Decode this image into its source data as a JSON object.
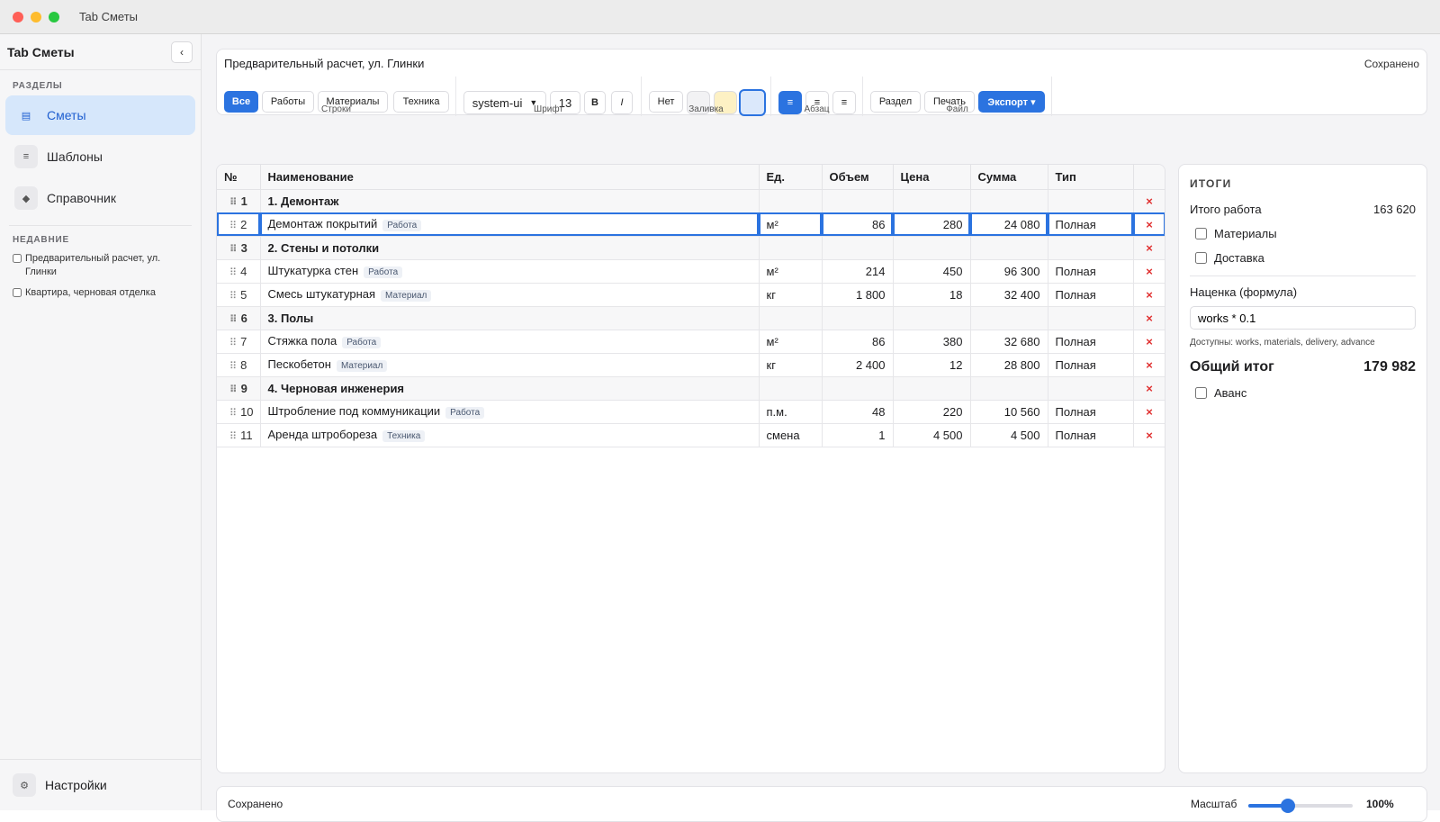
{
  "window": {
    "title": "Tab Сметы"
  },
  "sidebar": {
    "title": "Tab Сметы",
    "collapse_label": "‹",
    "sections_label": "РАЗДЕЛЫ",
    "items": [
      {
        "label": "Сметы",
        "icon": "▤",
        "active": true
      },
      {
        "label": "Шаблоны",
        "icon": "≡",
        "active": false
      },
      {
        "label": "Справочник",
        "icon": "◆",
        "active": false
      }
    ],
    "recent_label": "НЕДАВНИЕ",
    "recent": [
      {
        "label": "Предварительный расчет, ул. Глинки"
      },
      {
        "label": "Квартира, черновая отделка"
      }
    ],
    "settings": {
      "label": "Настройки",
      "icon": "⚙"
    }
  },
  "toolbar": {
    "doc_title": "Предварительный расчет, ул. Глинки",
    "status": "Сохранено",
    "rows_group": {
      "label": "Строки",
      "buttons": [
        "Все",
        "Работы",
        "Материалы",
        "Техника"
      ]
    },
    "font_group": {
      "label": "Шрифт",
      "font": "system-ui",
      "size": "13",
      "bold": "B",
      "italic": "I"
    },
    "fill_group": {
      "label": "Заливка",
      "none": "Нет",
      "colors": [
        "#f2f2f4",
        "#fdf1c4",
        "#dbe8fb"
      ]
    },
    "para_group": {
      "label": "Абзац",
      "buttons": [
        "≡",
        "≡",
        "≡"
      ]
    },
    "file_group": {
      "label": "Файл",
      "section": "Раздел",
      "print": "Печать",
      "export": "Экспорт ▾"
    }
  },
  "table": {
    "columns": [
      "№",
      "Наименование",
      "Ед.",
      "Объем",
      "Цена",
      "Сумма",
      "Тип",
      ""
    ],
    "rows": [
      {
        "n": "1",
        "name": "1. Демонтаж",
        "section": true
      },
      {
        "n": "2",
        "name": "Демонтаж покрытий",
        "tag": "Работа",
        "unit": "м²",
        "qty": "86",
        "price": "280",
        "sum": "24 080",
        "type": "Полная",
        "selected": true
      },
      {
        "n": "3",
        "name": "2. Стены и потолки",
        "section": true
      },
      {
        "n": "4",
        "name": "Штукатурка стен",
        "tag": "Работа",
        "unit": "м²",
        "qty": "214",
        "price": "450",
        "sum": "96 300",
        "type": "Полная"
      },
      {
        "n": "5",
        "name": "Смесь штукатурная",
        "tag": "Материал",
        "unit": "кг",
        "qty": "1 800",
        "price": "18",
        "sum": "32 400",
        "type": "Полная"
      },
      {
        "n": "6",
        "name": "3. Полы",
        "section": true
      },
      {
        "n": "7",
        "name": "Стяжка пола",
        "tag": "Работа",
        "unit": "м²",
        "qty": "86",
        "price": "380",
        "sum": "32 680",
        "type": "Полная"
      },
      {
        "n": "8",
        "name": "Пескобетон",
        "tag": "Материал",
        "unit": "кг",
        "qty": "2 400",
        "price": "12",
        "sum": "28 800",
        "type": "Полная"
      },
      {
        "n": "9",
        "name": "4. Черновая инженерия",
        "section": true
      },
      {
        "n": "10",
        "name": "Штробление под коммуникации",
        "tag": "Работа",
        "unit": "п.м.",
        "qty": "48",
        "price": "220",
        "sum": "10 560",
        "type": "Полная"
      },
      {
        "n": "11",
        "name": "Аренда штробореза",
        "tag": "Техника",
        "unit": "смена",
        "qty": "1",
        "price": "4 500",
        "sum": "4 500",
        "type": "Полная"
      }
    ],
    "delete_glyph": "×",
    "grip_glyph": "⠿"
  },
  "totals": {
    "heading": "ИТОГИ",
    "works_label": "Итого работа",
    "works_value": "163 620",
    "materials_label": "Материалы",
    "delivery_label": "Доставка",
    "markup_label": "Наценка (формула)",
    "markup_formula": "works * 0.1",
    "hint": "Доступны: works, materials, delivery, advance",
    "grand_label": "Общий итог",
    "grand_value": "179 982",
    "advance_label": "Аванс"
  },
  "statusbar": {
    "text": "Сохранено",
    "zoom_label": "Масштаб",
    "zoom_value": "100%",
    "zoom_fraction": 0.38
  },
  "colors": {
    "accent": "#2b73e0",
    "delete": "#e03030"
  }
}
